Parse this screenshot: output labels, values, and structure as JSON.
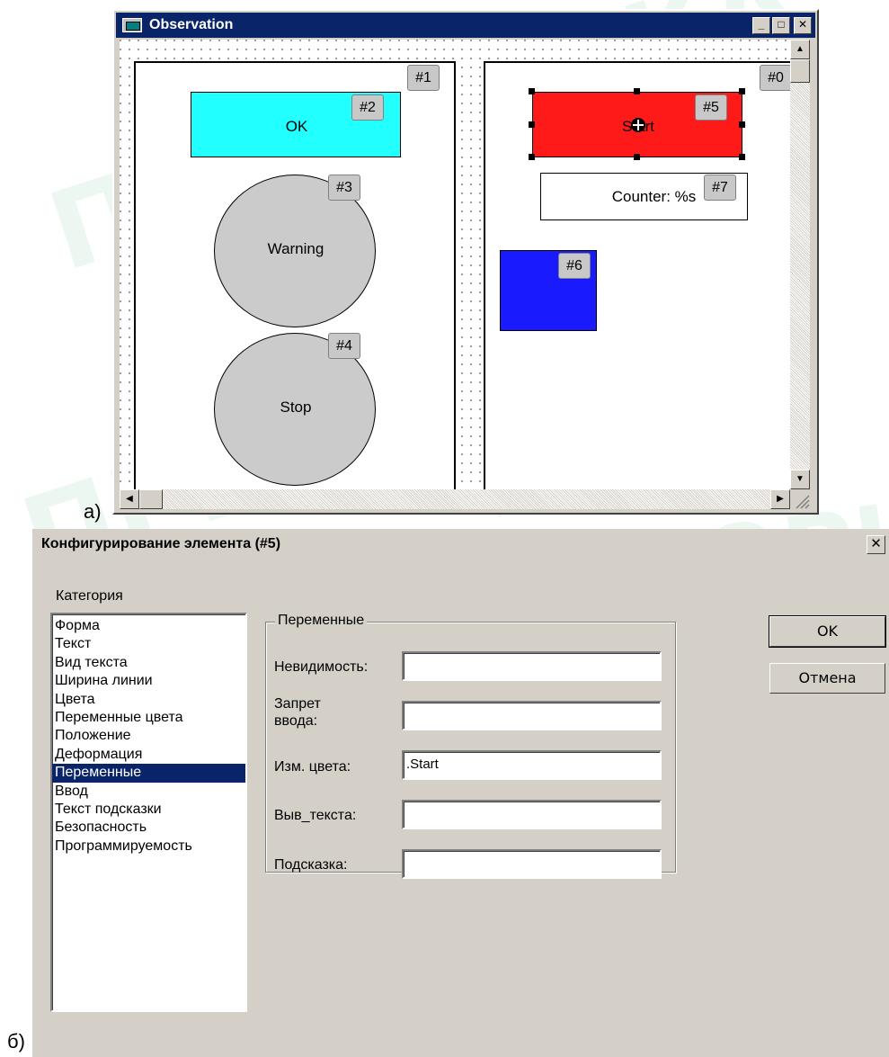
{
  "panel_labels": {
    "a": "а)",
    "b": "б)"
  },
  "watermark": {
    "word": "ПРИБОРИКА",
    "firm": "фирма"
  },
  "observation_window": {
    "title": "Observation",
    "title_icon": "window-app-icon",
    "controls": {
      "minimize": "_",
      "maximize": "□",
      "close": "✕"
    },
    "frames": {
      "left_tag": "#1",
      "right_tag": "#0"
    },
    "elements": {
      "ok": {
        "tag": "#2",
        "label": "OK",
        "color": "#22ffff"
      },
      "warning": {
        "tag": "#3",
        "label": "Warning",
        "color": "#cbcbcb"
      },
      "stop": {
        "tag": "#4",
        "label": "Stop",
        "color": "#cbcbcb"
      },
      "start": {
        "tag": "#5",
        "label": "Start",
        "color": "#ff1a1a",
        "selected": true
      },
      "blue_square": {
        "tag": "#6",
        "color": "#1a1aff"
      },
      "counter": {
        "tag": "#7",
        "label": "Counter: %s"
      }
    },
    "scrollbar_arrows": {
      "up": "▲",
      "down": "▼",
      "left": "◀",
      "right": "▶"
    }
  },
  "config_dialog": {
    "title": "Конфигурирование элемента (#5)",
    "close": "✕",
    "category_label": "Категория",
    "categories": [
      "Форма",
      "Текст",
      "Вид текста",
      "Ширина линии",
      "Цвета",
      "Переменные цвета",
      "Положение",
      "Деформация",
      "Переменные",
      "Ввод",
      "Текст подсказки",
      "Безопасность",
      "Программируемость"
    ],
    "selected_category_index": 8,
    "group_title": "Переменные",
    "fields": {
      "invisibility": {
        "label": "Невидимость:",
        "value": ""
      },
      "input_lock": {
        "label_line1": "Запрет",
        "label_line2": "ввода:",
        "value": ""
      },
      "color_change": {
        "label": "Изм. цвета:",
        "value": ".Start"
      },
      "text_output": {
        "label": "Выв_текста:",
        "value": ""
      },
      "tooltip": {
        "label": "Подсказка:",
        "value": ""
      }
    },
    "buttons": {
      "ok": "OK",
      "cancel": "Отмена"
    }
  }
}
